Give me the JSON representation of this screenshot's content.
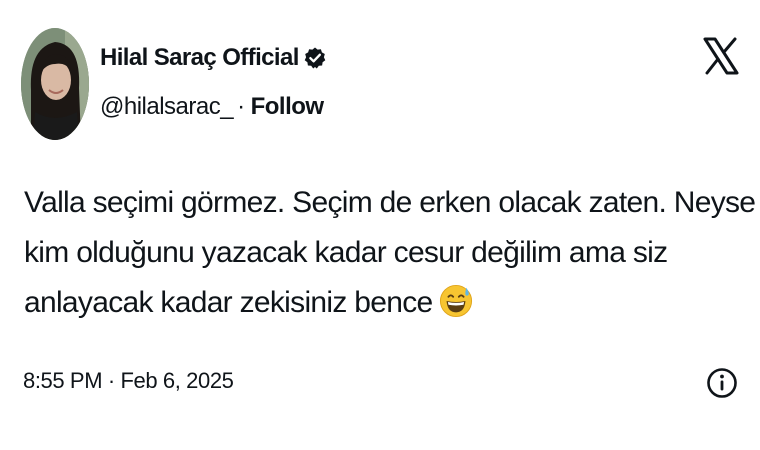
{
  "author": {
    "display_name": "Hilal Saraç Official",
    "handle": "@hilalsarac_",
    "separator": "·",
    "follow_label": "Follow",
    "verified": true,
    "avatar_icon": "avatar-photo"
  },
  "platform": {
    "logo_icon": "x-logo-icon"
  },
  "tweet": {
    "lines": [
      "Valla seçimi görmez. Seçim de erken olacak zaten. Neyse",
      "kim olduğunu yazacak kadar cesur değilim ama siz",
      "anlayacak kadar zekisiniz bence"
    ],
    "emoji": "grinning-face-with-sweat-icon",
    "timestamp": "8:55 PM · Feb 6, 2025"
  },
  "actions": {
    "info_icon": "info-icon"
  },
  "colors": {
    "text": "#0f1419",
    "background": "#ffffff"
  }
}
